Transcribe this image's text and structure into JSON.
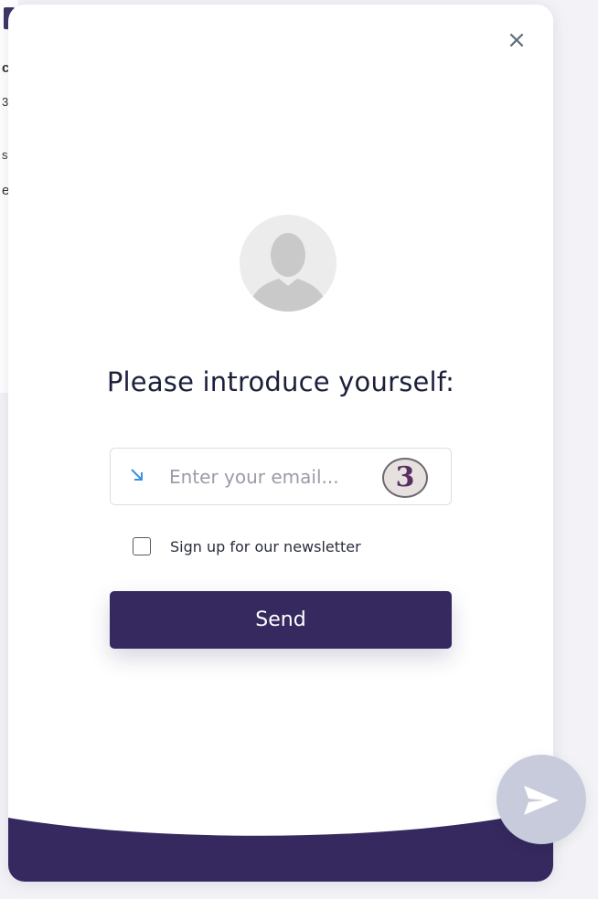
{
  "background": {
    "text_fragments": [
      "c",
      "3",
      "s",
      "e"
    ]
  },
  "dialog": {
    "close_glyph": "×",
    "title": "Please introduce yourself:",
    "email": {
      "value": "",
      "placeholder": "Enter your email...",
      "icon": "arrow-down-right-icon",
      "step_badge": "3"
    },
    "newsletter": {
      "label": "Sign up for our newsletter",
      "checked": false
    },
    "send_label": "Send"
  },
  "launcher": {
    "icon": "paper-plane-icon"
  },
  "colors": {
    "brand": "#35295f",
    "launcher": "#c8cbdc",
    "email_icon": "#3b8fe0",
    "badge_text": "#5a2e63"
  }
}
